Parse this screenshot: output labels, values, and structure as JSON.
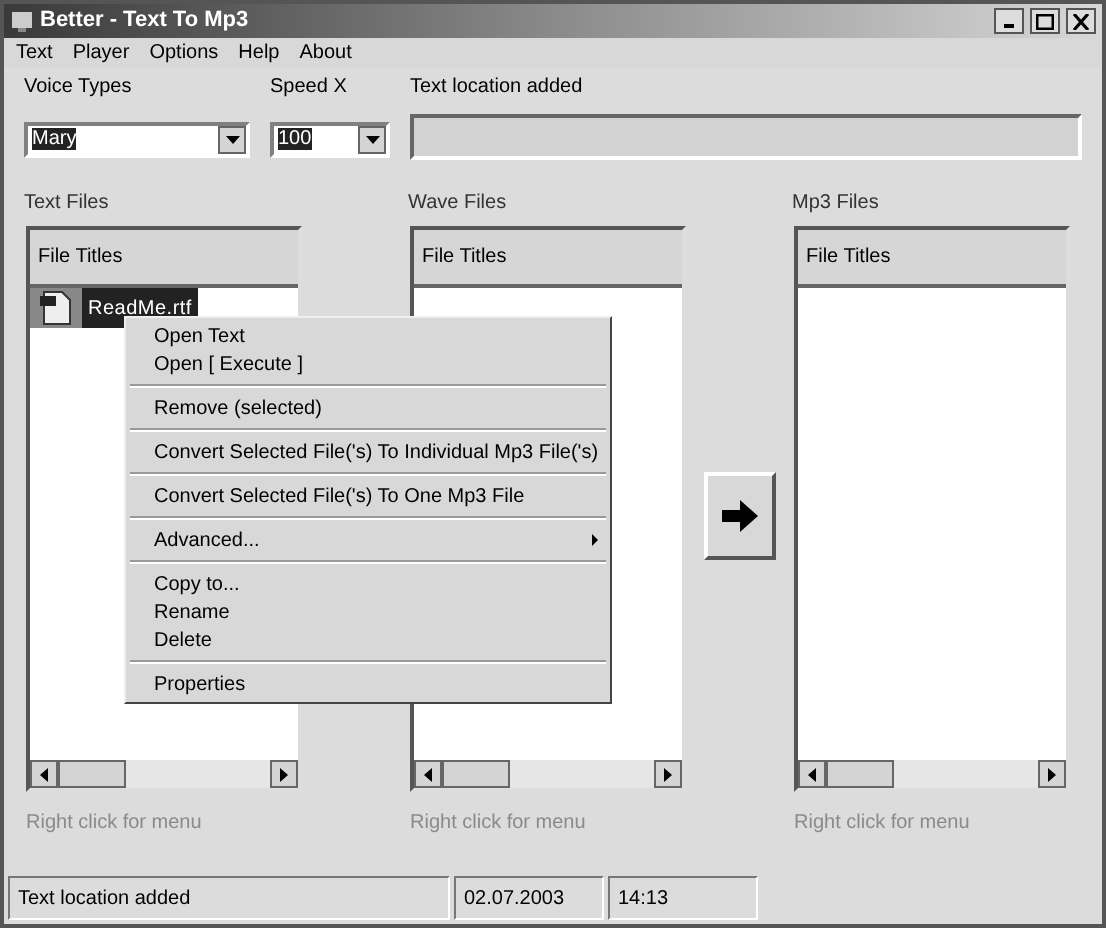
{
  "window": {
    "title": "Better - Text To Mp3"
  },
  "menu": [
    "Text",
    "Player",
    "Options",
    "Help",
    "About"
  ],
  "voice": {
    "label": "Voice Types",
    "value": "Mary"
  },
  "speed": {
    "label": "Speed X",
    "value": "100"
  },
  "location": {
    "label": "Text location added"
  },
  "panels": [
    {
      "label": "Text Files",
      "header": "File Titles",
      "items": [
        {
          "name": "ReadMe.rtf",
          "selected": true
        }
      ],
      "hint": "Right click for menu"
    },
    {
      "label": "Wave Files",
      "header": "File Titles",
      "hint": "Right click for menu"
    },
    {
      "label": "Mp3 Files",
      "header": "File Titles",
      "hint": "Right click for menu"
    }
  ],
  "context_menu": [
    {
      "kind": "item",
      "label": "Open Text"
    },
    {
      "kind": "item",
      "label": "Open [ Execute ]"
    },
    {
      "kind": "separator"
    },
    {
      "kind": "item",
      "label": "Remove (selected)"
    },
    {
      "kind": "separator"
    },
    {
      "kind": "item",
      "label": "Convert Selected File('s) To Individual Mp3 File('s)"
    },
    {
      "kind": "separator"
    },
    {
      "kind": "item",
      "label": "Convert Selected File('s) To One Mp3 File"
    },
    {
      "kind": "separator"
    },
    {
      "kind": "submenu",
      "label": "Advanced..."
    },
    {
      "kind": "separator"
    },
    {
      "kind": "item",
      "label": "Copy to..."
    },
    {
      "kind": "item",
      "label": "Rename"
    },
    {
      "kind": "item",
      "label": "Delete"
    },
    {
      "kind": "separator"
    },
    {
      "kind": "item",
      "label": "Properties"
    }
  ],
  "status_bar": [
    "Text location added",
    "02.07.2003",
    "14:13"
  ]
}
